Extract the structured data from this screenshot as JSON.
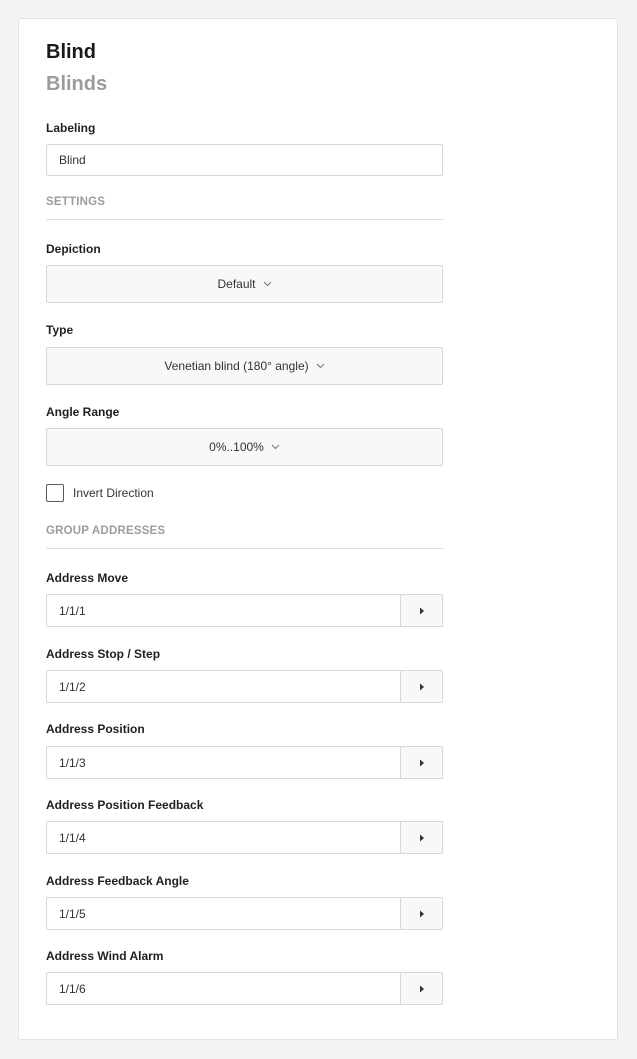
{
  "header": {
    "title": "Blind",
    "subtitle": "Blinds"
  },
  "labeling": {
    "label": "Labeling",
    "value": "Blind"
  },
  "settings": {
    "section_label": "SETTINGS",
    "depiction": {
      "label": "Depiction",
      "value": "Default"
    },
    "type": {
      "label": "Type",
      "value": "Venetian blind (180° angle)"
    },
    "angle_range": {
      "label": "Angle Range",
      "value": "0%..100%"
    },
    "invert_direction": {
      "label": "Invert Direction",
      "checked": false
    }
  },
  "group_addresses": {
    "section_label": "GROUP ADDRESSES",
    "items": [
      {
        "label": "Address Move",
        "value": "1/1/1"
      },
      {
        "label": "Address Stop / Step",
        "value": "1/1/2"
      },
      {
        "label": "Address Position",
        "value": "1/1/3"
      },
      {
        "label": "Address Position Feedback",
        "value": "1/1/4"
      },
      {
        "label": "Address Feedback Angle",
        "value": "1/1/5"
      },
      {
        "label": "Address Wind Alarm",
        "value": "1/1/6"
      }
    ]
  },
  "icons": {
    "select_chevron": "chevron-down-icon",
    "address_button": "caret-right-icon"
  },
  "colors": {
    "background": "#f3f3f3",
    "card": "#ffffff",
    "subtitle": "#9b9b9b",
    "section_label": "#9d9d9d",
    "border": "#d7d7d7"
  }
}
